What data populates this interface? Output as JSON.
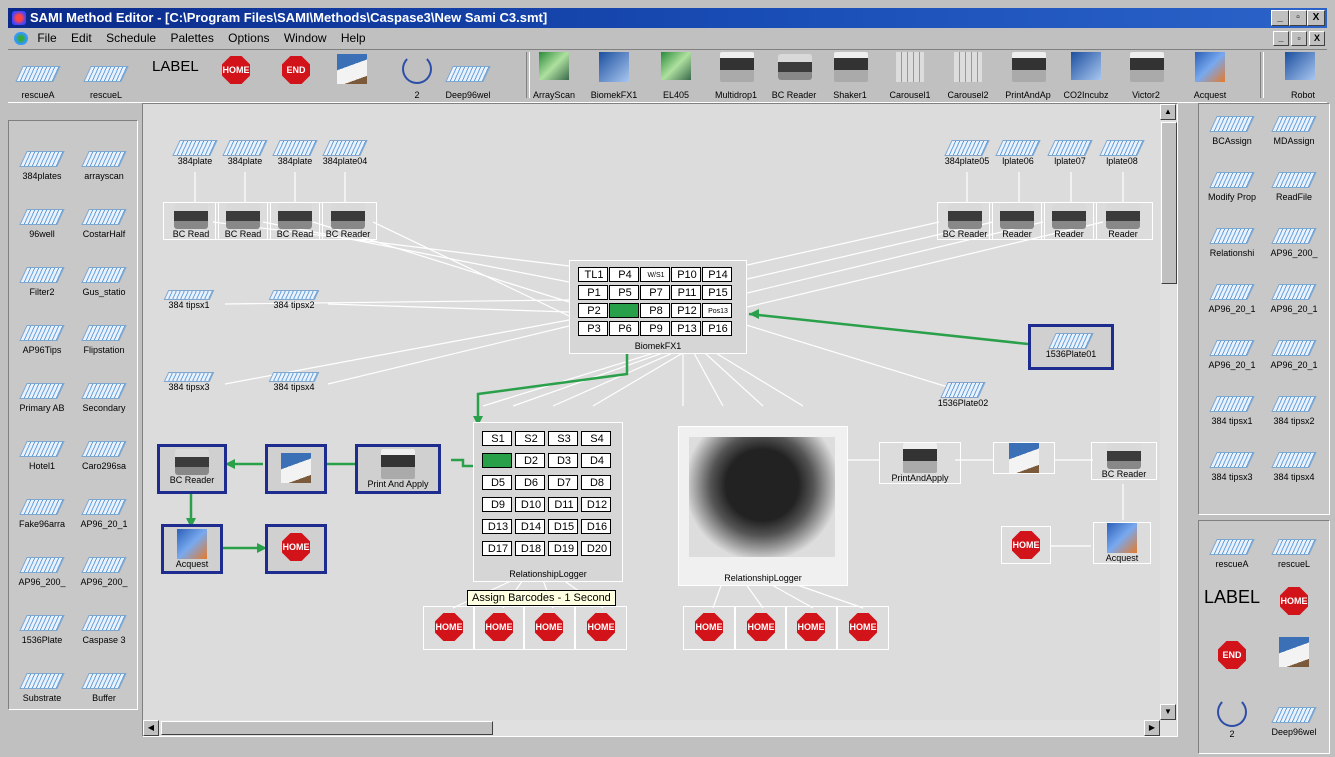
{
  "window": {
    "title": "SAMI Method Editor - [C:\\Program Files\\SAMI\\Methods\\Caspase3\\New Sami C3.smt]",
    "buttons": [
      "_",
      "▫",
      "X"
    ]
  },
  "menu": [
    "File",
    "Edit",
    "Schedule",
    "Palettes",
    "Options",
    "Window",
    "Help"
  ],
  "toolbar": {
    "left": [
      {
        "label": "rescueA",
        "icon": "plate-icon"
      },
      {
        "label": "rescueL",
        "icon": "plate-icon"
      },
      {
        "label": "LABEL",
        "icon": "label-icon"
      },
      {
        "label": "HOME",
        "icon": "home-stop-icon"
      },
      {
        "label": "END",
        "icon": "end-stop-icon"
      },
      {
        "label": "",
        "icon": "house-icon"
      },
      {
        "label": "2",
        "icon": "loop-icon"
      },
      {
        "label": "Deep96wel",
        "icon": "plate-icon"
      }
    ],
    "right": [
      {
        "label": "ArrayScan"
      },
      {
        "label": "BiomekFX1"
      },
      {
        "label": "EL405"
      },
      {
        "label": "Multidrop1"
      },
      {
        "label": "BC Reader"
      },
      {
        "label": "Shaker1"
      },
      {
        "label": "Carousel1"
      },
      {
        "label": "Carousel2"
      },
      {
        "label": "PrintAndAp"
      },
      {
        "label": "CO2Incubz"
      },
      {
        "label": "Victor2"
      },
      {
        "label": "Acquest"
      },
      {
        "label": "Robot"
      }
    ]
  },
  "left_palette": [
    [
      "384plates",
      "arrayscan"
    ],
    [
      "96well",
      "CostarHalf"
    ],
    [
      "Filter2",
      "Gus_statio"
    ],
    [
      "AP96Tips",
      "Flipstation"
    ],
    [
      "Primary AB",
      "Secondary"
    ],
    [
      "Hotel1",
      "Caro296sa"
    ],
    [
      "Fake96arra",
      "AP96_20_1"
    ],
    [
      "AP96_200_",
      "AP96_200_"
    ],
    [
      "1536Plate",
      "Caspase 3"
    ],
    [
      "Substrate",
      "Buffer"
    ]
  ],
  "right_palette_top": [
    [
      "BCAssign",
      "MDAssign"
    ],
    [
      "Modify Prop",
      "ReadFile"
    ],
    [
      "Relationshi",
      "AP96_200_"
    ],
    [
      "AP96_20_1",
      "AP96_20_1"
    ],
    [
      "AP96_20_1",
      "AP96_20_1"
    ],
    [
      "384 tipsx1",
      "384 tipsx2"
    ],
    [
      "384 tipsx3",
      "384 tipsx4"
    ]
  ],
  "right_palette_bottom": {
    "row1": [
      "rescueA",
      "rescueL"
    ],
    "label": "LABEL",
    "home": "HOME",
    "end": "END",
    "loop_count": "2",
    "deep": "Deep96wel"
  },
  "canvas": {
    "plates_left": [
      "384plate",
      "384plate",
      "384plate",
      "384plate04"
    ],
    "readers_left": [
      "BC Read",
      "BC Read",
      "BC Read",
      "BC Reader"
    ],
    "plates_right": [
      "384plate05",
      "lplate06",
      "lplate07",
      "lplate08"
    ],
    "readers_right": [
      "BC Reader",
      "Reader",
      "Reader",
      "Reader"
    ],
    "tips": [
      "384 tipsx1",
      "384 tipsx2",
      "384 tipsx3",
      "384 tipsx4"
    ],
    "biomek": {
      "label": "BiomekFX1",
      "cells": [
        [
          "TL1",
          "P4",
          "W/S1",
          "P10",
          "P14"
        ],
        [
          "P1",
          "P5",
          "P7",
          "P11",
          "P15"
        ],
        [
          "P2",
          "",
          "P8",
          "P12",
          "Pos13"
        ],
        [
          "P3",
          "P6",
          "P9",
          "P13",
          "P16"
        ]
      ]
    },
    "plate_1536_01": "1536Plate01",
    "plate_1536_02": "1536Plate02",
    "logger1": {
      "label": "RelationshipLogger",
      "cells": [
        [
          "S1",
          "S2",
          "S3",
          "S4"
        ],
        [
          "",
          "D2",
          "D3",
          "D4"
        ],
        [
          "D5",
          "D6",
          "D7",
          "D8"
        ],
        [
          "D9",
          "D10",
          "D11",
          "D12"
        ],
        [
          "D13",
          "D14",
          "D15",
          "D16"
        ],
        [
          "D17",
          "D18",
          "D19",
          "D20"
        ]
      ]
    },
    "logger2_label": "RelationshipLogger",
    "tooltip": "Assign Barcodes - 1 Second",
    "left_flow": {
      "reader": "BC Reader",
      "printer": "Print And Apply",
      "acquest": "Acquest"
    },
    "right_flow": {
      "printer": "PrintAndApply",
      "reader": "BC Reader",
      "acquest": "Acquest"
    },
    "home_label": "HOME"
  }
}
